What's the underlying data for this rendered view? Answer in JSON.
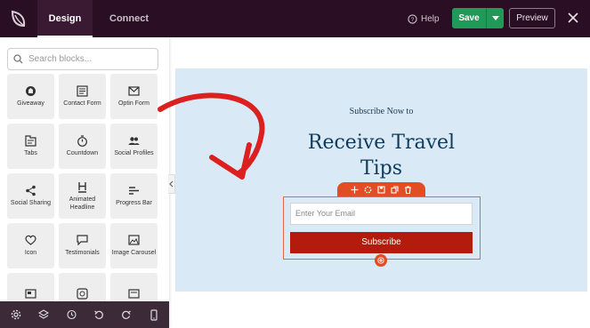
{
  "topbar": {
    "logo_icon": "leaf-logo-icon",
    "tabs": [
      {
        "label": "Design",
        "active": true
      },
      {
        "label": "Connect",
        "active": false
      }
    ],
    "help_label": "Help",
    "save_label": "Save",
    "preview_label": "Preview",
    "colors": {
      "bar": "#2a0e24",
      "save": "#1f9a59"
    }
  },
  "sidebar": {
    "search_placeholder": "Search blocks...",
    "blocks": [
      {
        "label": "Giveaway",
        "icon": "giveaway-icon"
      },
      {
        "label": "Contact Form",
        "icon": "contact-form-icon"
      },
      {
        "label": "Optin Form",
        "icon": "envelope-icon"
      },
      {
        "label": "Tabs",
        "icon": "tabs-icon"
      },
      {
        "label": "Countdown",
        "icon": "stopwatch-icon"
      },
      {
        "label": "Social Profiles",
        "icon": "people-icon"
      },
      {
        "label": "Social Sharing",
        "icon": "share-icon"
      },
      {
        "label": "Animated Headline",
        "icon": "heading-icon"
      },
      {
        "label": "Progress Bar",
        "icon": "progress-bar-icon"
      },
      {
        "label": "Icon",
        "icon": "heart-icon"
      },
      {
        "label": "Testimonials",
        "icon": "speech-bubble-icon"
      },
      {
        "label": "Image Carousel",
        "icon": "image-carousel-icon"
      },
      {
        "label": "",
        "icon": "block-icon"
      },
      {
        "label": "",
        "icon": "block-icon"
      },
      {
        "label": "",
        "icon": "block-icon"
      }
    ]
  },
  "bottombar": {
    "icons": [
      "settings-icon",
      "layers-icon",
      "history-icon",
      "undo-icon",
      "redo-icon",
      "mobile-preview-icon"
    ]
  },
  "canvas": {
    "subtitle": "Subscribe Now to",
    "heading_line1": "Receive Travel",
    "heading_line2": "Tips",
    "email_placeholder": "Enter Your Email",
    "button_label": "Subscribe",
    "colors": {
      "section_bg": "#d9eaf6",
      "heading": "#0f3a5b",
      "button": "#b31b0c",
      "accent": "#e24d24"
    }
  }
}
